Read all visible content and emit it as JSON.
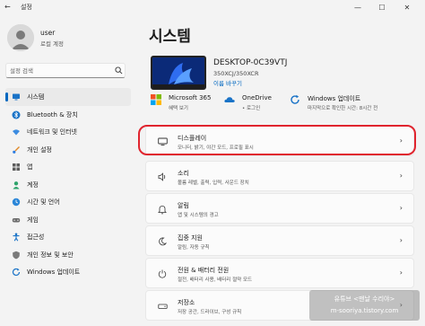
{
  "window": {
    "title": "설정",
    "controls": {
      "minimize": "—",
      "maximize": "☐",
      "close": "✕"
    }
  },
  "profile": {
    "name": "user",
    "subtitle": "로컬 계정"
  },
  "search": {
    "placeholder": "설정 검색"
  },
  "sidebar": {
    "items": [
      {
        "label": "시스템",
        "icon": "monitor-icon",
        "active": true
      },
      {
        "label": "Bluetooth & 장치",
        "icon": "bluetooth-icon"
      },
      {
        "label": "네트워크 및 인터넷",
        "icon": "wifi-icon"
      },
      {
        "label": "개인 설정",
        "icon": "brush-icon"
      },
      {
        "label": "앱",
        "icon": "apps-icon"
      },
      {
        "label": "계정",
        "icon": "account-icon"
      },
      {
        "label": "시간 및 언어",
        "icon": "globe-clock-icon"
      },
      {
        "label": "게임",
        "icon": "gamepad-icon"
      },
      {
        "label": "접근성",
        "icon": "accessibility-icon"
      },
      {
        "label": "개인 정보 및 보안",
        "icon": "shield-icon"
      },
      {
        "label": "Windows 업데이트",
        "icon": "update-icon"
      }
    ]
  },
  "main": {
    "title": "시스템",
    "device": {
      "name": "DESKTOP-0C39VTJ",
      "model": "350XCJ/350XCR",
      "rename": "이름 바꾸기"
    },
    "quick": [
      {
        "title": "Microsoft 365",
        "sub": "혜택 보기",
        "icon": "microsoft-icon"
      },
      {
        "title": "OneDrive",
        "sub": "• 로그인",
        "icon": "onedrive-icon"
      },
      {
        "title": "Windows 업데이트",
        "sub": "마지막으로 확인한 시간: 8시간 전",
        "icon": "update-icon"
      }
    ],
    "cards": [
      {
        "title": "디스플레이",
        "sub": "모니터, 밝기, 야간 모드, 프로필 표시",
        "icon": "display-icon"
      },
      {
        "title": "소리",
        "sub": "볼륨 레벨, 출력, 입력, 사운드 장치",
        "icon": "speaker-icon"
      },
      {
        "title": "알림",
        "sub": "앱 및 시스템의 경고",
        "icon": "bell-icon"
      },
      {
        "title": "집중 지원",
        "sub": "알림, 자동 규칙",
        "icon": "moon-icon"
      },
      {
        "title": "전원 & 배터리 전원",
        "sub": "절전, 배터리 사용, 배터리 절약 모드",
        "icon": "power-icon"
      },
      {
        "title": "저장소",
        "sub": "저장 공간, 드라이브, 구성 규칙",
        "icon": "storage-icon"
      }
    ],
    "chevron": "›"
  },
  "watermark": {
    "line1": "유튜브 <맨날 수리야>",
    "line2": "m-sooriya.tistory.com"
  },
  "colors": {
    "accent": "#0067c0",
    "highlight": "#e0242e",
    "background": "#f3f3f3"
  }
}
